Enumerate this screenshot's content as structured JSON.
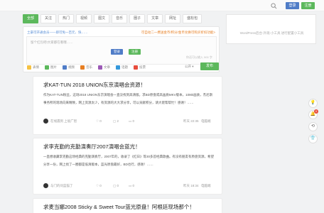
{
  "header": {
    "login_label": "登录",
    "register_label": "注册"
  },
  "tabs": [
    "全部",
    "关注",
    "热门",
    "视频",
    "图文",
    "音乐",
    "圈子",
    "文章",
    "网址",
    "盛松包"
  ],
  "composer": {
    "notice_left": "土豪可开通会员——即可免一百元、快……",
    "notice_right": "可自动二一费送金币/积分/金币兑换可购买折扣功能>",
    "placeholder": "留个红包吧!大家都在看哦……",
    "login_label": "登录",
    "register_label": "注册",
    "counter": "你还可以输入 500 字"
  },
  "toolbar": {
    "items": [
      "表情",
      "图片",
      "视频",
      "音乐",
      "文章",
      "话题",
      "投票"
    ],
    "public_label": "公开",
    "publish_label": "发布"
  },
  "sidebar": {
    "text": "WordPress后台-外观-小工具 进行配置小工具"
  },
  "floating": {
    "badge_count": "0"
  },
  "colors": {
    "accent_green": "#5cb85c",
    "accent_blue": "#4f7cc7",
    "badge_red": "#e74c3c"
  },
  "posts": [
    {
      "title": "求KAT-TUN 2018 UNION东京演唱会资源！",
      "body": "作为KAT-TUN粉丝，这场2018 UNION东京演唱会一直没找到高清版。求BD原盘或高画质MKV版本，1080i画质，杰尼斯事务所的现场向来精致，网上资源太少，有资源的大大求分享，可以贡献积分，请大佬帮帮忙！感谢！……",
      "author": "在线遇到 上坂广智",
      "views": "0",
      "likes": "2",
      "comments": "0",
      "time": "昨天 22:35",
      "edit": "电脑端"
    },
    {
      "title": "求李克勤的克勤演奏厅2007演唱会蓝光！",
      "body": "一直想收藏李克勤这场经典的克勤演奏厅，2007年的，收录了《红日》等30多首经典歌曲。有没有朋友有原盘资源，希望分享一份，网上找了一圈都是低清版本，蓝光原盘最好，BD也行，感谢！……",
      "author": "与门的问蓝猫了",
      "views": "0",
      "likes": "0",
      "comments": "0",
      "time": "昨天 18:34",
      "edit": "电脑端"
    },
    {
      "title": "求麦当娜2008 Sticky & Sweet Tour蓝光原盘！阿根廷现场那个！"
    }
  ]
}
